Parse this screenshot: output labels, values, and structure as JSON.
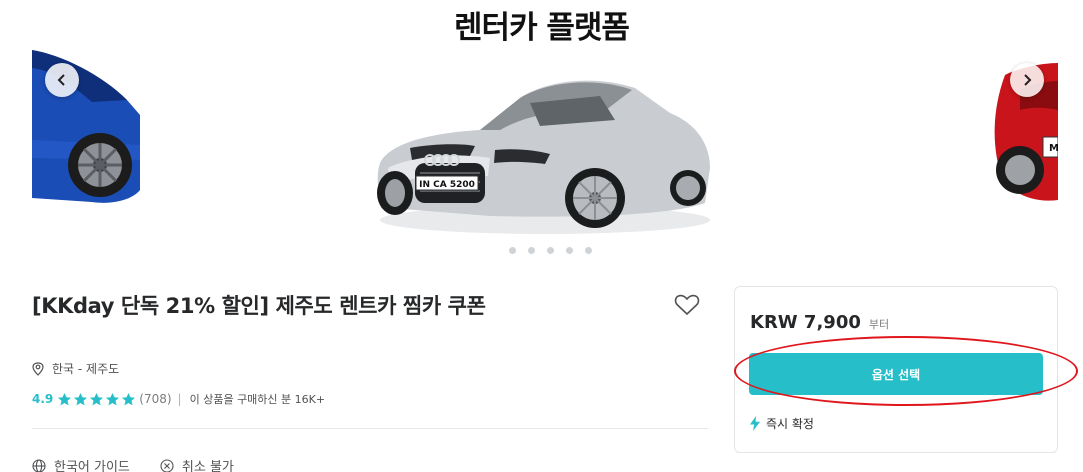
{
  "carousel": {
    "banner_title": "렌터카 플랫폼",
    "plate_text": "IN CA 5200",
    "right_plate_text": "M",
    "slide_count": 5,
    "active_slide": 1,
    "prev_icon": "chevron-left-icon",
    "next_icon": "chevron-right-icon"
  },
  "product": {
    "title": "[KKday 단독 21% 할인] 제주도 렌트카 찜카 쿠폰",
    "location": "한국 - 제주도",
    "rating": "4.9",
    "stars": 5,
    "review_count": "(708)",
    "separator": "|",
    "bought_text": "이 상품을 구매하신 분 16K+",
    "features": [
      {
        "icon": "globe-icon",
        "label": "한국어 가이드"
      },
      {
        "icon": "cancel-circle-icon",
        "label": "취소 불가"
      }
    ]
  },
  "booking": {
    "price": "KRW 7,900",
    "price_suffix": "부터",
    "option_button": "옵션 선택",
    "instant_confirm": "즉시 확정"
  },
  "colors": {
    "accent": "#26bec9",
    "highlight": "#e0161d",
    "text": "#26282a"
  }
}
